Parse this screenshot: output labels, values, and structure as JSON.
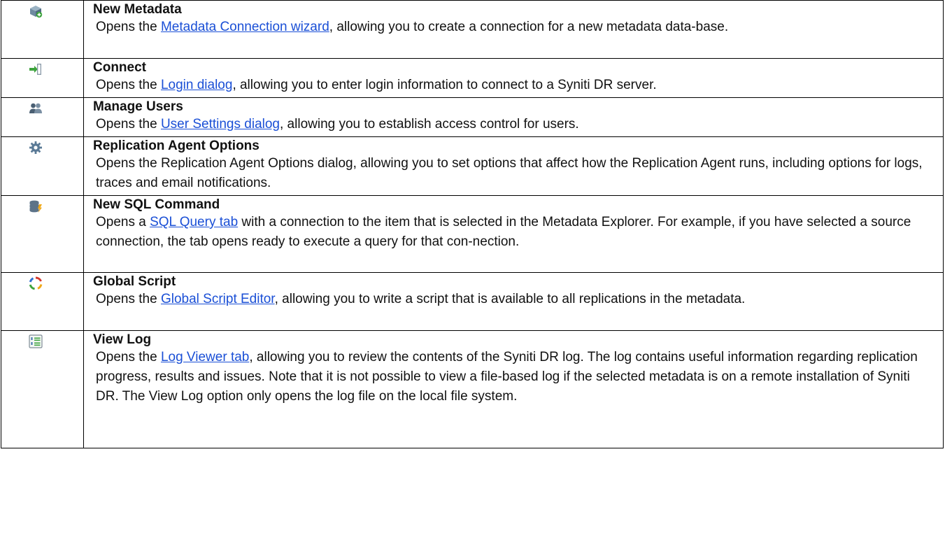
{
  "rows": [
    {
      "icon": "new-metadata-icon",
      "title": "New Metadata",
      "pre": "Opens the ",
      "link": "Metadata Connection wizard",
      "post": ", allowing you to create a connection for a new metadata data-base."
    },
    {
      "icon": "connect-icon",
      "title": "Connect",
      "pre": "Opens the ",
      "link": "Login dialog",
      "post": ", allowing you to enter login information to connect to a Syniti DR server."
    },
    {
      "icon": "manage-users-icon",
      "title": "Manage Users",
      "pre": "Opens the ",
      "link": "User Settings dialog",
      "post": ", allowing you to establish access control for users."
    },
    {
      "icon": "gear-icon",
      "title": "Replication Agent Options",
      "pre": "Opens the Replication Agent Options dialog, allowing you to set options that affect how the Replication Agent runs, including options for logs, traces and email notifications.",
      "link": "",
      "post": ""
    },
    {
      "icon": "database-sql-icon",
      "title": "New SQL Command",
      "pre": "Opens a ",
      "link": "SQL Query tab",
      "post": " with a connection to the item that is selected in the Metadata Explorer. For example, if you have selected a source connection, the tab opens ready to execute a query for that con-nection."
    },
    {
      "icon": "global-script-icon",
      "title": "Global Script",
      "pre": "Opens the ",
      "link": "Global Script Editor",
      "post": ", allowing you to write a script that is available to all replications in the metadata."
    },
    {
      "icon": "numbered-list-icon",
      "title": "View Log",
      "pre": "Opens the ",
      "link": "Log Viewer tab",
      "post": ", allowing you to review the contents of the Syniti DR log. The log contains useful information regarding  replication progress, results and issues. Note that it is not possible to view a file-based log if the selected metadata is on a remote installation of Syniti DR. The View Log option only opens the log file on the local file system."
    }
  ]
}
